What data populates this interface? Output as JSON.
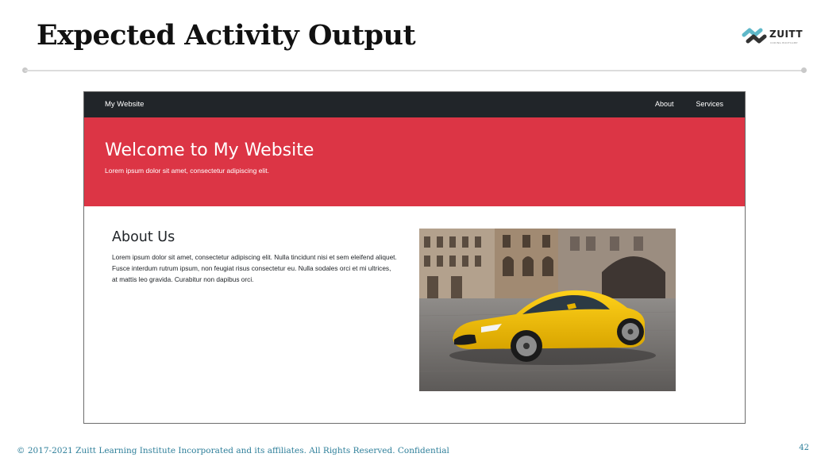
{
  "slide": {
    "title": "Expected Activity Output",
    "logo_name": "ZUITT",
    "logo_tagline": "CODING BOOTCAMP",
    "footer_text": "© 2017-2021 Zuitt Learning Institute Incorporated and its affiliates. All Rights Reserved. Confidential",
    "page_number": "42"
  },
  "website": {
    "brand": "My Website",
    "nav_links": [
      "About",
      "Services"
    ],
    "hero": {
      "title": "Welcome to My Website",
      "subtitle": "Lorem ipsum dolor sit amet, consectetur adipiscing elit."
    },
    "about": {
      "title": "About Us",
      "text": "Lorem ipsum dolor sit amet, consectetur adipiscing elit. Nulla tincidunt nisi et sem eleifend aliquet. Fusce interdum rutrum ipsum, non feugiat risus consectetur eu. Nulla sodales orci et mi ultrices, at mattis leo gravida. Curabitur non dapibus orci."
    },
    "image_subject": "yellow sports car on cobblestone square"
  },
  "colors": {
    "navbar": "#212529",
    "hero": "#dc3545",
    "footer_text": "#2e7f9a",
    "logo_accent": "#5fb8c9"
  }
}
